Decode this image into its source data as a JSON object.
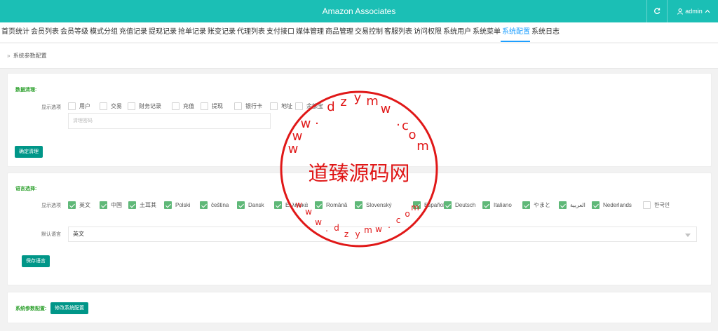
{
  "header": {
    "title": "Amazon Associates",
    "user_label": "admin"
  },
  "nav": {
    "items": [
      "首页统计",
      "会员列表",
      "会员等级",
      "模式分组",
      "充值记录",
      "提现记录",
      "抢单记录",
      "账变记录",
      "代理列表",
      "支付接口",
      "媒体管理",
      "商品管理",
      "交易控制",
      "客服列表",
      "访问权限",
      "系统用户",
      "系统菜单",
      "系统配置",
      "系统日志"
    ],
    "active_index": 17
  },
  "breadcrumb": {
    "separator": "»",
    "label": "系统参数配置"
  },
  "clean": {
    "title": "数据清理:",
    "options_label": "显示选项",
    "options": [
      "用户",
      "交易",
      "财务记录",
      "充值",
      "提现",
      "银行卡",
      "地址",
      "余额宝"
    ],
    "password_placeholder": "清理密码",
    "button_label": "确定清理"
  },
  "language": {
    "title": "语言选择:",
    "options_label": "显示选项",
    "options": [
      "英文",
      "中国",
      "土耳其",
      "Polski",
      "čeština",
      "Dansk",
      "Ελληνικά",
      "Română",
      "Slovenský",
      "Español",
      "Deutsch",
      "Italiano",
      "やまと",
      "العربية",
      "Nederlands",
      "한국인"
    ],
    "checked": [
      true,
      true,
      true,
      true,
      true,
      true,
      true,
      true,
      true,
      true,
      true,
      true,
      true,
      true,
      true,
      false
    ],
    "default_label": "默认语言",
    "default_value": "英文",
    "save_label": "保存语言"
  },
  "sysconfig": {
    "title": "系统参数配置:",
    "button_label": "修改系统配置"
  },
  "watermark": {
    "upper_arc": "www.dzymw.com",
    "center": "道臻源码网",
    "lower_arc": "www.dzymw.com",
    "color": "#e01818"
  },
  "colors": {
    "topbar": "#1bbfb5",
    "primary_button": "#009688",
    "checkbox_checked": "#5fb878",
    "section_title": "#2fa12f",
    "active_nav": "#1e9fff"
  }
}
